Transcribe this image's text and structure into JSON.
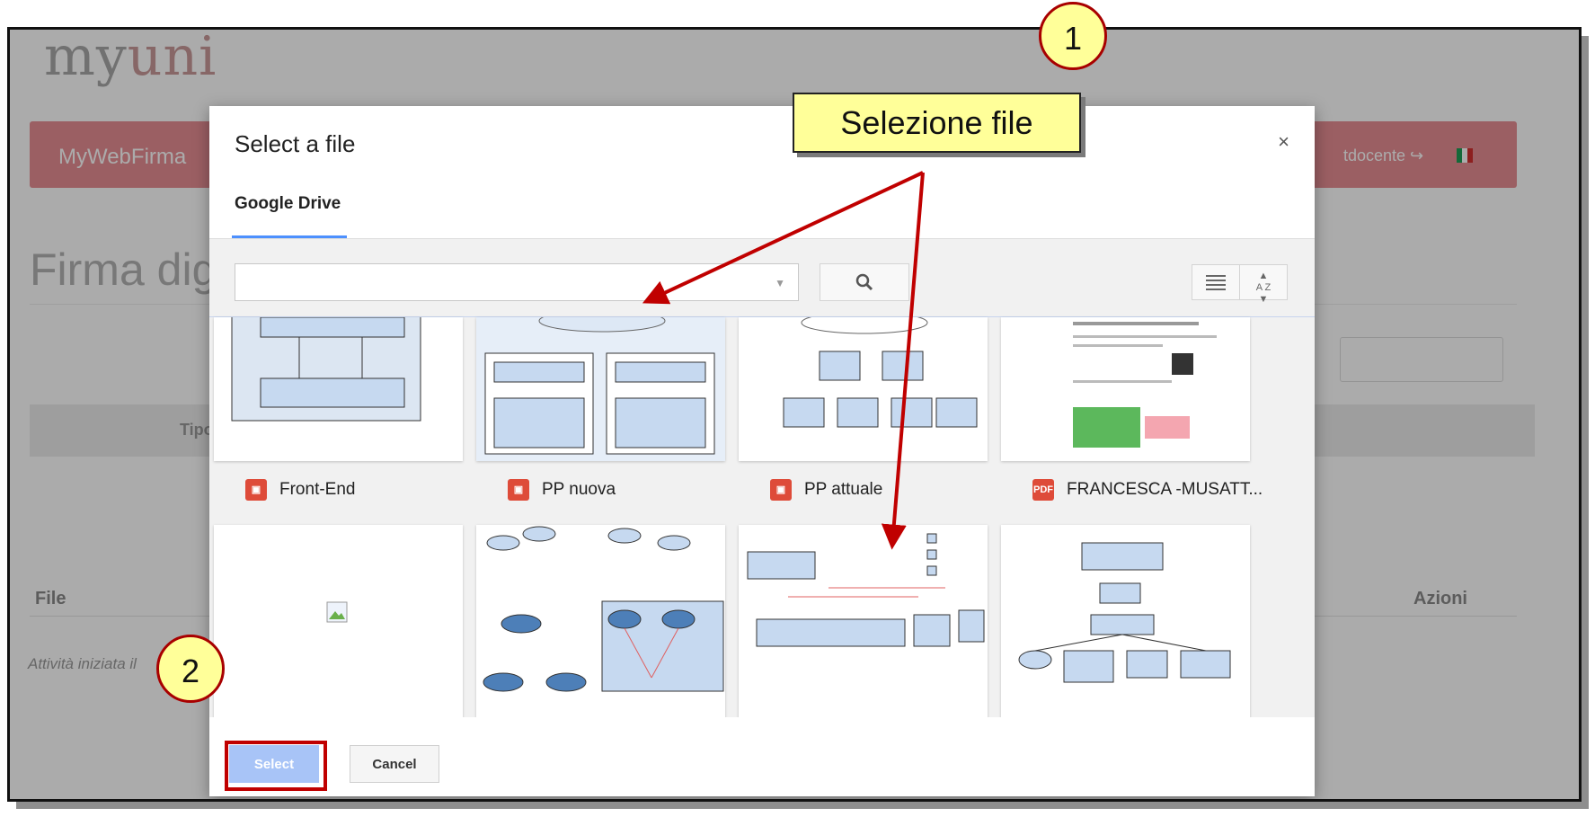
{
  "background": {
    "logo_prefix": "my",
    "logo_suffix": "uni",
    "nav_brand": "MyWebFirma",
    "nav_user": "tdocente ↪",
    "page_title": "Firma dig",
    "table_header_tipo": "Tipo",
    "col_file": "File",
    "col_azioni": "Azioni",
    "note": "Attività iniziata il"
  },
  "dialog": {
    "title": "Select a file",
    "close": "×",
    "tab": "Google Drive",
    "search_placeholder": "",
    "sort_glyph": "A Z",
    "files": [
      {
        "label": "Front-End",
        "type": "slides"
      },
      {
        "label": "PP nuova",
        "type": "slides"
      },
      {
        "label": "PP attuale",
        "type": "slides"
      },
      {
        "label": "FRANCESCA -MUSATT...",
        "type": "pdf"
      }
    ],
    "select_label": "Select",
    "cancel_label": "Cancel"
  },
  "annotations": {
    "callout": "Selezione file",
    "step1": "1",
    "step2": "2"
  },
  "icons": {
    "slides": "slides-icon",
    "pdf": "pdf-icon",
    "search": "search-icon",
    "list": "list-view-icon",
    "sort": "sort-az-icon",
    "broken_image": "broken-image-icon"
  },
  "colors": {
    "navbar": "#e88e94",
    "accent": "#4d90fe",
    "select_button": "#a8c4f7",
    "highlight_border": "#c00000",
    "callout_bg": "#ffff99",
    "arrow": "#c00000"
  }
}
